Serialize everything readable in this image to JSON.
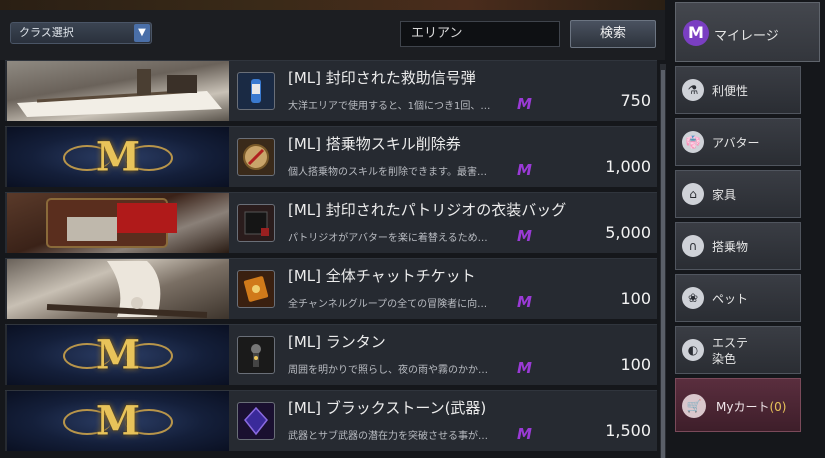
{
  "toolbar": {
    "class_select": "クラス選択",
    "search_value": "エリアン",
    "search_button": "検索"
  },
  "items": [
    {
      "name": "[ML] 封印された救助信号弾",
      "desc": "大洋エリアで使用すると、1個につき1回、…",
      "price": "750",
      "thumb": "photo",
      "icon": "flare-icon"
    },
    {
      "name": "[ML] 搭乗物スキル削除券",
      "desc": "個人搭乗物のスキルを削除できます。最害…",
      "price": "1,000",
      "thumb": "emblem",
      "icon": "compass-icon"
    },
    {
      "name": "[ML] 封印されたパトリジオの衣装バッグ",
      "desc": "パトリジオがアバターを楽に着替えるため…",
      "price": "5,000",
      "thumb": "photo",
      "icon": "bag-icon"
    },
    {
      "name": "[ML] 全体チャットチケット",
      "desc": "全チャンネルグループの全ての冒険者に向…",
      "price": "100",
      "thumb": "photo",
      "icon": "ticket-icon"
    },
    {
      "name": "[ML] ランタン",
      "desc": "周囲を明かりで照らし、夜の雨や霧のかか…",
      "price": "100",
      "thumb": "emblem",
      "icon": "lantern-icon"
    },
    {
      "name": "[ML] ブラックストーン(武器)",
      "desc": "武器とサブ武器の潜在力を突破させる事が…",
      "price": "1,500",
      "thumb": "emblem",
      "icon": "blackstone-icon"
    }
  ],
  "sidebar": {
    "mileage": "マイレージ",
    "tabs": [
      {
        "label": "利便性",
        "icon": "potion-icon"
      },
      {
        "label": "アバター",
        "icon": "costume-icon"
      },
      {
        "label": "家具",
        "icon": "chair-icon"
      },
      {
        "label": "搭乗物",
        "icon": "horseshoe-icon"
      },
      {
        "label": "ペット",
        "icon": "paw-icon"
      },
      {
        "label": "エステ\n染色",
        "icon": "hair-icon"
      }
    ],
    "cart_label": "Myカート",
    "cart_count": "(0)"
  },
  "colors": {
    "mileage_purple": "#7a3fc2",
    "m_mark": "#9a3ad6",
    "cart_bg": "#5a2e3e"
  }
}
